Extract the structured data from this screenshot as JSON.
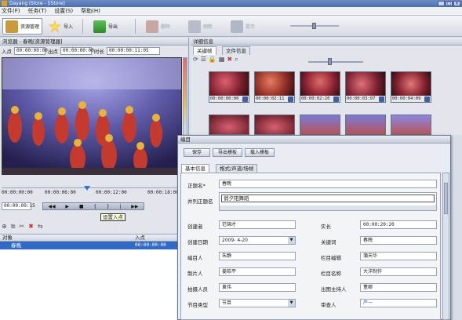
{
  "window": {
    "title": "Dayang iStore - [iStore]"
  },
  "menu": [
    "文件(F)",
    "任务(T)",
    "设置(S)",
    "帮助(H)"
  ],
  "toolbar": {
    "buttons": [
      {
        "label": "资源管理",
        "icon": "folder-icon"
      },
      {
        "label": "导入",
        "icon": "star-icon"
      },
      {
        "label": "导出",
        "icon": "export-icon"
      },
      {
        "label": "删除",
        "icon": "delete-icon"
      },
      {
        "label": "刷新",
        "icon": "refresh-icon"
      },
      {
        "label": "提示",
        "icon": "hint-icon"
      }
    ]
  },
  "browser": {
    "title": "浏览器 - 春晚[资源管理器]",
    "in_label": "入点",
    "in_value": "00:00:00:00",
    "out_label": "出点",
    "out_value": "00:00:00:00",
    "dur_label": "时长",
    "dur_value": "00:00:00:11:05",
    "timeline_ticks": [
      "00:00:00:00",
      "00:00:06:00",
      "00:00:12:00",
      "00:00:18:00"
    ],
    "position": "00:00:09:15",
    "tooltip": "设置入点"
  },
  "object_list": {
    "headers": [
      "对象",
      "入点"
    ],
    "rows": [
      {
        "name": "春晚",
        "in": "00:00:00:00"
      }
    ]
  },
  "detail": {
    "title": "详细信息",
    "tabs": [
      "关键帧",
      "文件信息"
    ],
    "keyframes": [
      "00:00:00:00",
      "00:00:02:11",
      "00:00:02:20",
      "00:00:03:07",
      "00:00:04:09"
    ]
  },
  "catalog": {
    "title": "编目",
    "buttons": [
      "保存",
      "导出模板",
      "载入模板"
    ],
    "tabs": [
      "基本信息",
      "格式/声道/场帧"
    ],
    "fields": {
      "title_label": "正题名*",
      "title_value": "春晚",
      "parallel_label": "并列正题名",
      "parallel_value": "俏夕阳舞蹈",
      "creator_label": "创建者",
      "creator_value": "范锦才",
      "length_label": "实长",
      "length_value": "00:00:20:20",
      "date_label": "创建日期",
      "date_value": "2009- 4-20",
      "keyword_label": "关键词",
      "keyword_value": "春晚",
      "editor_label": "编目人",
      "editor_value": "朱静",
      "column_editor_label": "栏目编辑",
      "column_editor_value": "蒲天华",
      "producer_label": "制片人",
      "producer_value": "姜皓平",
      "column_name_label": "栏目名称",
      "column_name_value": "大洋制作",
      "camera_label": "拍摄人员",
      "camera_value": "黄伟",
      "host_label": "出图主持人",
      "host_value": "董卿",
      "type_label": "节目类型",
      "type_value": "节目",
      "reviewer_label": "审查人",
      "reviewer_value": "严一"
    }
  }
}
